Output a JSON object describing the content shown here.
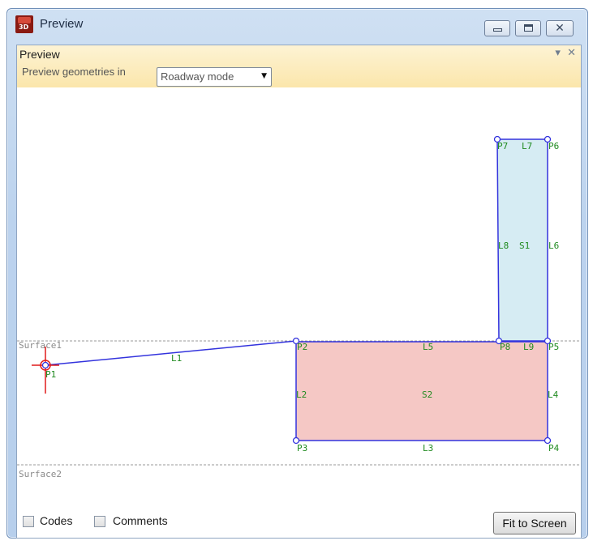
{
  "window": {
    "title": "Preview",
    "icon": "app-3d-icon",
    "icon_text": "3D",
    "controls": [
      "minimize",
      "maximize",
      "close"
    ]
  },
  "panel": {
    "title": "Preview",
    "header_controls": {
      "pin": "▾",
      "close": "✕"
    },
    "mode_label": "Preview geometries in",
    "mode_select": {
      "value": "Roadway mode",
      "arrow": "▼"
    }
  },
  "canvas": {
    "surfaces": [
      "Surface1",
      "Surface2"
    ],
    "points": [
      "P1",
      "P2",
      "P3",
      "P4",
      "P5",
      "P6",
      "P7",
      "P8"
    ],
    "links": [
      "L1",
      "L2",
      "L3",
      "L4",
      "L5",
      "L6",
      "L7",
      "L8",
      "L9"
    ],
    "shapes": [
      "S1",
      "S2"
    ],
    "colors": {
      "link": "#3333dd",
      "label": "#1f8a1f",
      "surface_line": "#9a9a9a",
      "s1_fill": "#d6ecf3",
      "s2_fill": "#f5c8c5",
      "origin": "#e01a1a"
    }
  },
  "footer": {
    "codes_label": "Codes",
    "comments_label": "Comments",
    "fit_button": "Fit to Screen"
  }
}
